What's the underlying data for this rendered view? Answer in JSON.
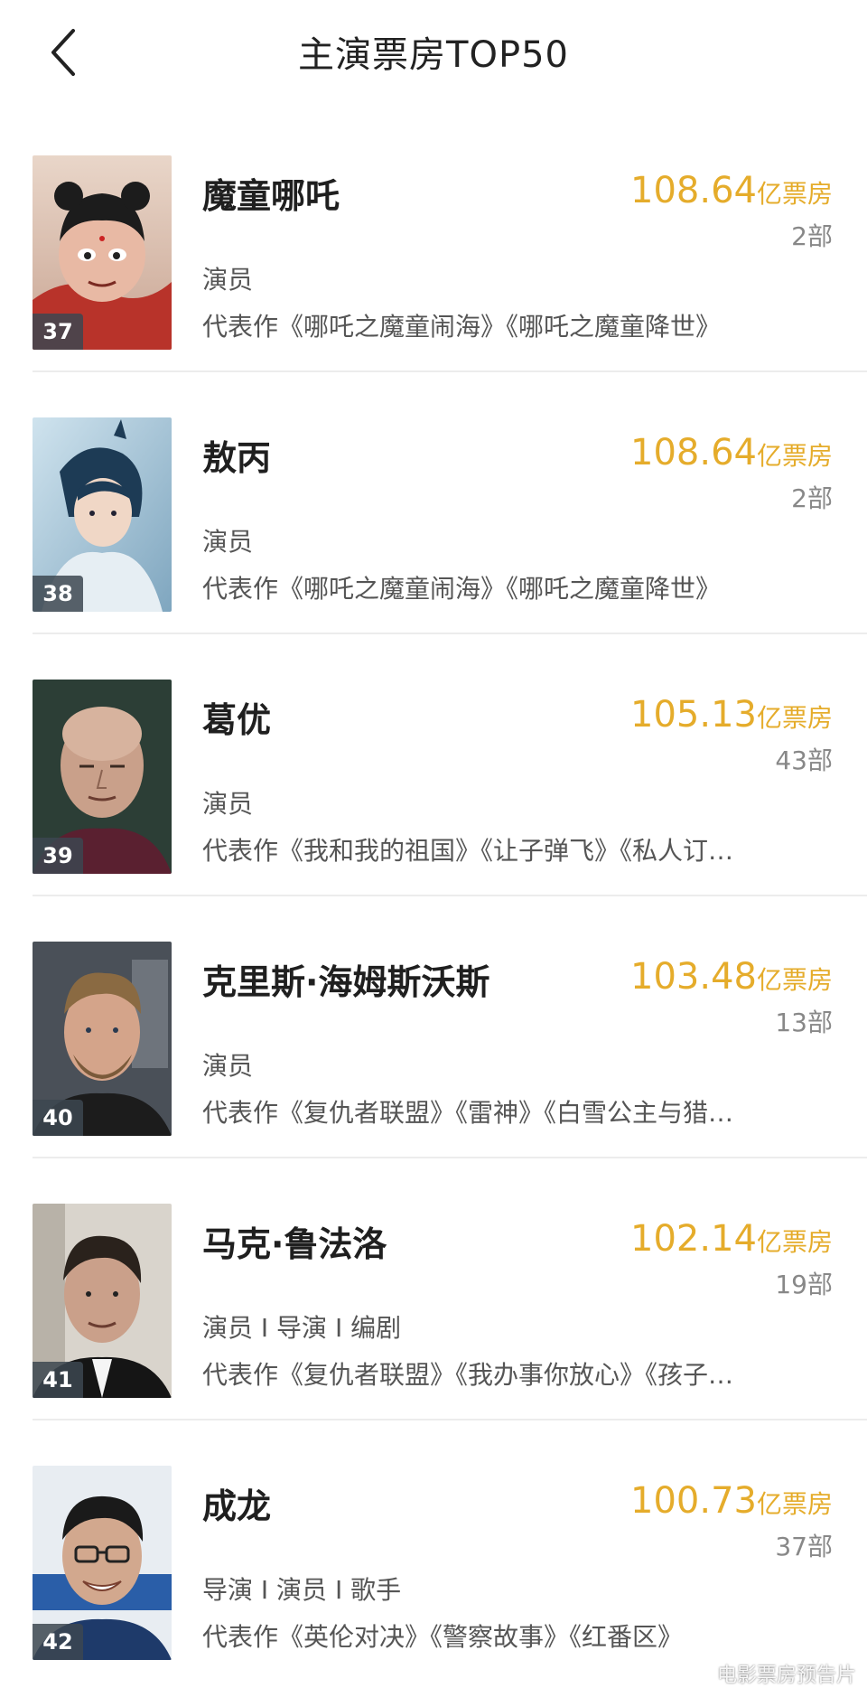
{
  "header": {
    "title": "主演票房TOP50",
    "back_icon": "chevron-left-icon"
  },
  "colors": {
    "accent_gold": "#e5ac2b",
    "highlight_border": "#f0913a"
  },
  "items": [
    {
      "rank": "37",
      "name": "魔童哪吒",
      "gross": "108.64",
      "unit": "亿票房",
      "count": "2部",
      "role": "演员",
      "works": "代表作《哪吒之魔童闹海》《哪吒之魔童降世》",
      "highlight": true
    },
    {
      "rank": "38",
      "name": "敖丙",
      "gross": "108.64",
      "unit": "亿票房",
      "count": "2部",
      "role": "演员",
      "works": "代表作《哪吒之魔童闹海》《哪吒之魔童降世》",
      "highlight": false
    },
    {
      "rank": "39",
      "name": "葛优",
      "gross": "105.13",
      "unit": "亿票房",
      "count": "43部",
      "role": "演员",
      "works": "代表作《我和我的祖国》《让子弹飞》《私人订…",
      "highlight": false
    },
    {
      "rank": "40",
      "name": "克里斯·海姆斯沃斯",
      "gross": "103.48",
      "unit": "亿票房",
      "count": "13部",
      "role": "演员",
      "works": "代表作《复仇者联盟》《雷神》《白雪公主与猎…",
      "highlight": false
    },
    {
      "rank": "41",
      "name": "马克·鲁法洛",
      "gross": "102.14",
      "unit": "亿票房",
      "count": "19部",
      "role": "演员 I 导演 I 编剧",
      "works": "代表作《复仇者联盟》《我办事你放心》《孩子…",
      "highlight": false
    },
    {
      "rank": "42",
      "name": "成龙",
      "gross": "100.73",
      "unit": "亿票房",
      "count": "37部",
      "role": "导演 I 演员 I 歌手",
      "works": "代表作《英伦对决》《警察故事》《红番区》",
      "highlight": true
    }
  ],
  "watermark": "电影票房预告片"
}
